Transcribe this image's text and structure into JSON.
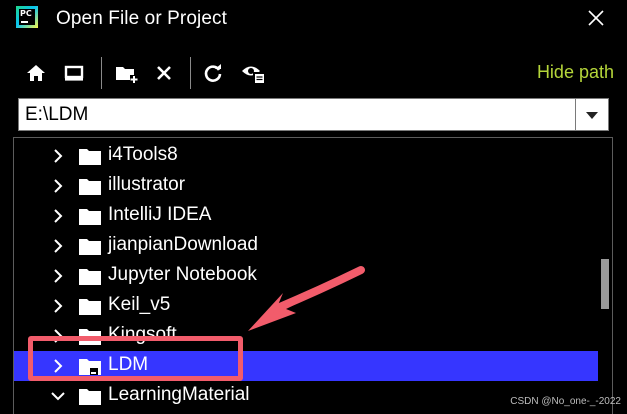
{
  "window": {
    "title": "Open File or Project",
    "logo_text": "PC"
  },
  "toolbar": {
    "icons": [
      "home-icon",
      "desktop-icon",
      "new-folder-icon",
      "delete-icon",
      "refresh-icon",
      "show-hidden-icon"
    ],
    "hide_path_label": "Hide path",
    "hide_path_color": "#b5d63a"
  },
  "path": {
    "value": "E:\\LDM"
  },
  "tree": {
    "items": [
      {
        "label": "i4Tools8",
        "expanded": false
      },
      {
        "label": "illustrator",
        "expanded": false
      },
      {
        "label": "IntelliJ IDEA",
        "expanded": false
      },
      {
        "label": "jianpianDownload",
        "expanded": false
      },
      {
        "label": "Jupyter Notebook",
        "expanded": false
      },
      {
        "label": "Keil_v5",
        "expanded": false
      },
      {
        "label": "Kingsoft",
        "expanded": false
      },
      {
        "label": "LDM",
        "expanded": false,
        "selected": true
      },
      {
        "label": "LearningMaterial",
        "expanded": true
      }
    ],
    "selection_color": "#3636ff"
  },
  "annotation": {
    "color": "#f25c6b"
  },
  "watermark": "CSDN @No_one-_-2022"
}
